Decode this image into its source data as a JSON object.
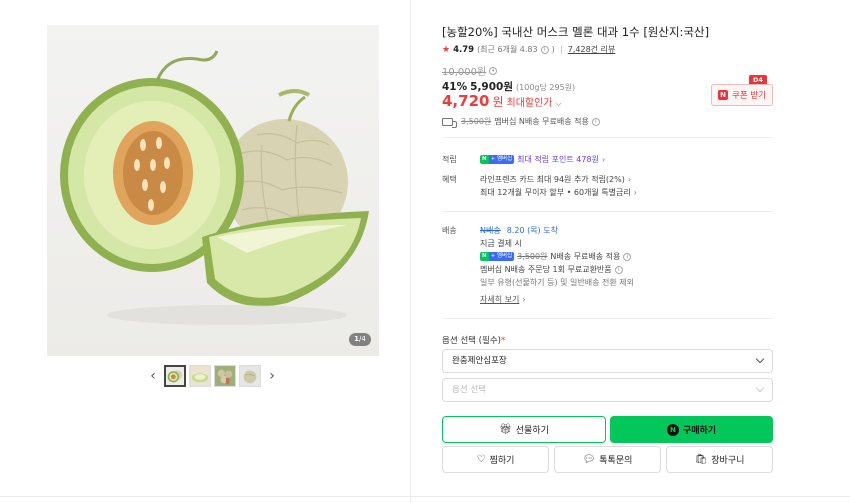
{
  "gallery": {
    "counter_current": "1",
    "counter_total": "/4",
    "prev_icon": "chevron-left-icon",
    "next_icon": "chevron-right-icon"
  },
  "product": {
    "title": "[농할20%] 국내산 머스크 멜론 대과 1수 [원산지:국산]",
    "rating": "4.79",
    "rating_recent": "(최근 6개월 4.83",
    "reviews": "7,428건 리뷰",
    "original_price": "10,000원",
    "discount_rate": "41%",
    "sale_price": "5,900원",
    "unit_price": "(100g당 295원)",
    "max_discount_amount": "4,720",
    "max_discount_won": "원",
    "max_discount_label": "최대할인가"
  },
  "coupon": {
    "badge": "D4",
    "icon_letter": "N",
    "label": "쿠폰 받기"
  },
  "shipping_summary": {
    "original_fee": "3,500원",
    "text": "멤버십 N배송 무료배송 적용"
  },
  "benefits": {
    "points_label": "적립",
    "points_badge_n": "N",
    "points_badge_plus": "+ 멤버십",
    "points_text": "최대 적립 포인트 478원",
    "benefit_label": "혜택",
    "benefit_line1": "라인프렌즈 카드 최대 94원 추가 적립(2%)",
    "benefit_line2": "최대 12개월 무이자 할부 • 60개월 특별금리"
  },
  "delivery": {
    "label": "배송",
    "tag": "N배송",
    "arrival": "8.20 (목) 도착",
    "pay_note": "지금 결제 시",
    "badge_n": "N",
    "badge_plus": "+ 멤버십",
    "fee_original": "3,500원",
    "fee_text": "N배송 무료배송 적용",
    "exchange_text": "멤버십 N배송 주문당 1회 무료교환반품",
    "note": "일부 유형(선물하기 등) 및 일반배송 전환 제외",
    "more_link": "자세히 보기"
  },
  "options": {
    "label": "옵션 선택 (필수)",
    "required_mark": "*",
    "select1_value": "완충제안심포장",
    "select2_placeholder": "옵션 선택"
  },
  "actions": {
    "gift": "선물하기",
    "buy_icon_letter": "N",
    "buy": "구매하기",
    "wish": "찜하기",
    "talk": "톡톡문의",
    "cart": "장바구니"
  },
  "colors": {
    "accent_green": "#03c75a",
    "price_red": "#f03b3b",
    "point_purple": "#6b3cf2",
    "arrival_blue": "#2b6ed6"
  }
}
